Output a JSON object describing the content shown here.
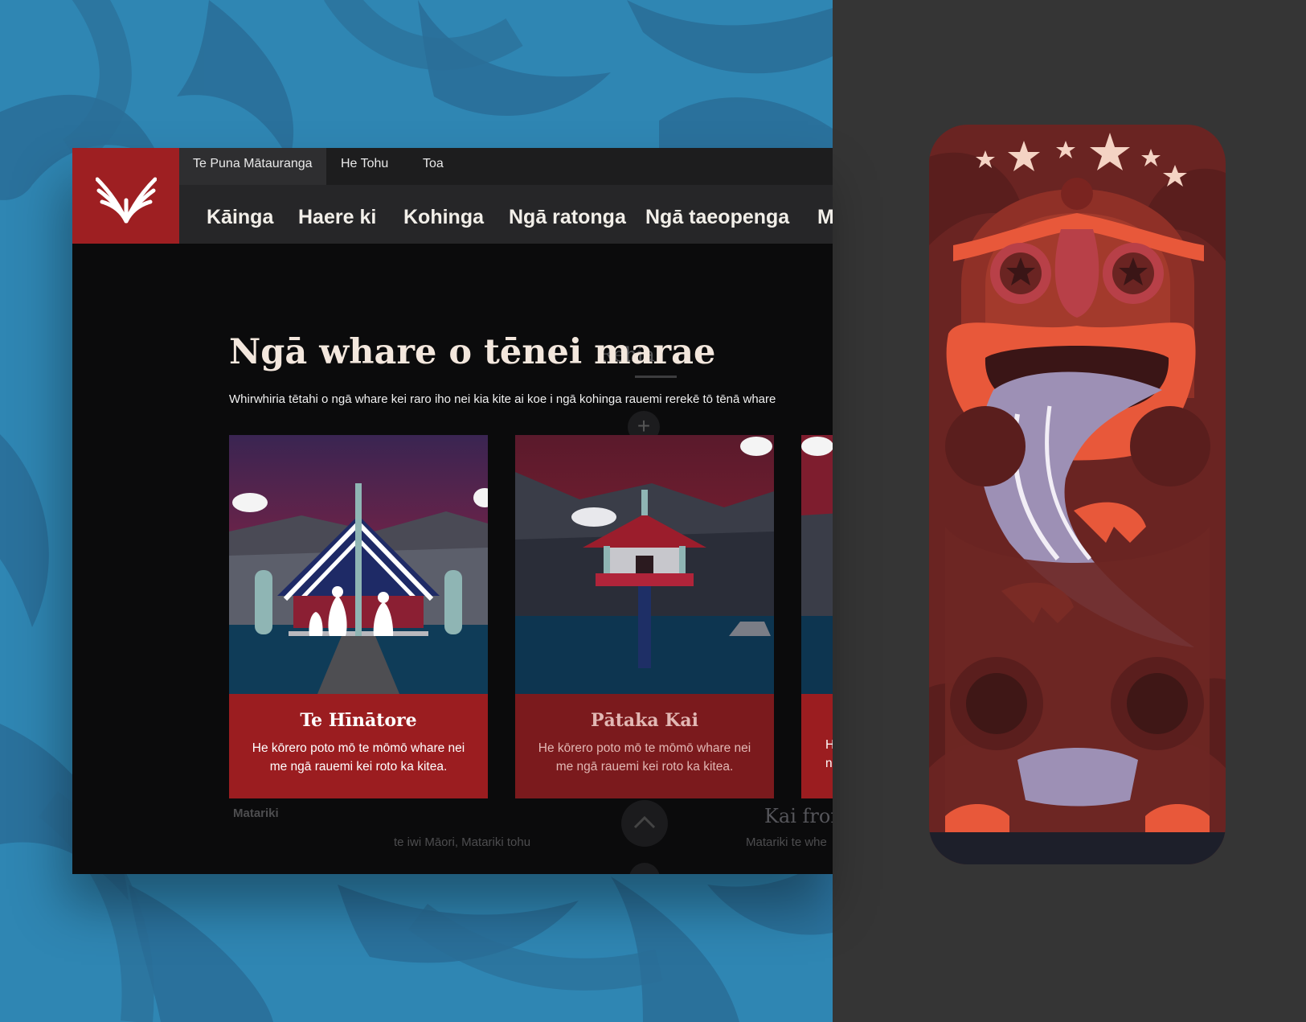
{
  "utility_nav": {
    "items": [
      {
        "label": "Te Puna Mātauranga",
        "active": true
      },
      {
        "label": "He Tohu",
        "active": false
      },
      {
        "label": "Toa",
        "active": false
      }
    ]
  },
  "main_nav": {
    "items": [
      {
        "label": "Kāinga"
      },
      {
        "label": "Haere ki"
      },
      {
        "label": "Kohinga"
      },
      {
        "label": "Ngā ratonga"
      },
      {
        "label": "Ngā taeopenga"
      },
      {
        "label": "M"
      }
    ]
  },
  "page": {
    "title": "Ngā whare o tēnei marae",
    "intro": "Whirwhiria tētahi o ngā whare kei raro iho nei kia kite ai koe i ngā kohinga rauemi rerekē tō tēnā whare",
    "ghost_heading": "Rēhia",
    "ghost_plus": "+"
  },
  "cards": [
    {
      "title": "Te Hīnātore",
      "description": "He kōrero poto mō te mōmō whare nei me ngā rauemi kei roto ka kitea."
    },
    {
      "title": "Pātaka Kai",
      "description": "He kōrero poto mō te mōmō whare nei me ngā rauemi kei roto ka kitea."
    },
    {
      "title": "",
      "description": "H n"
    }
  ],
  "ghost_bottom": {
    "matariki": "Matariki",
    "line1": "te iwi Māori, Matariki tohu",
    "kai_heading": "Kai from",
    "line2": "Matariki te whe"
  },
  "colors": {
    "brand_red": "#9e1f22",
    "left_bg": "#2f86b3",
    "right_bg": "#353535",
    "window_bg": "#0b0b0c"
  }
}
